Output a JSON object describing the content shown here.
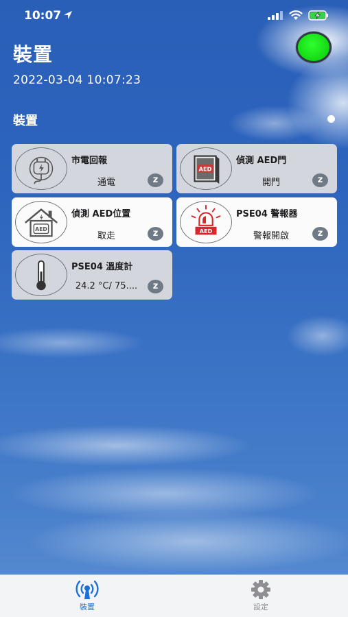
{
  "status_bar": {
    "time": "10:07"
  },
  "header": {
    "title": "裝置",
    "timestamp": "2022-03-04 10:07:23",
    "connection_color": "#1fe81f"
  },
  "section": {
    "title": "裝置"
  },
  "devices": [
    {
      "name": "市電回報",
      "value": "通電",
      "icon": "power-plug-icon",
      "badge": "z",
      "style": "gray"
    },
    {
      "name": "偵測 AED門",
      "value": "開門",
      "icon": "aed-door-icon",
      "badge": "z",
      "style": "gray"
    },
    {
      "name": "偵測 AED位置",
      "value": "取走",
      "icon": "aed-house-icon",
      "badge": "z",
      "style": "white"
    },
    {
      "name": "PSE04 警報器",
      "value": "警報開啟",
      "icon": "aed-alarm-icon",
      "badge": "z",
      "style": "white"
    },
    {
      "name": "PSE04 溫度計",
      "value": "24.2 °C/ 75....",
      "icon": "thermometer-icon",
      "badge": "z",
      "style": "gray"
    }
  ],
  "tabs": [
    {
      "label": "裝置",
      "icon": "antenna-icon",
      "active": true
    },
    {
      "label": "設定",
      "icon": "gear-icon",
      "active": false
    }
  ],
  "colors": {
    "accent": "#1c6fd6",
    "badge": "#6f7a86",
    "alarm_red": "#d9262b"
  }
}
